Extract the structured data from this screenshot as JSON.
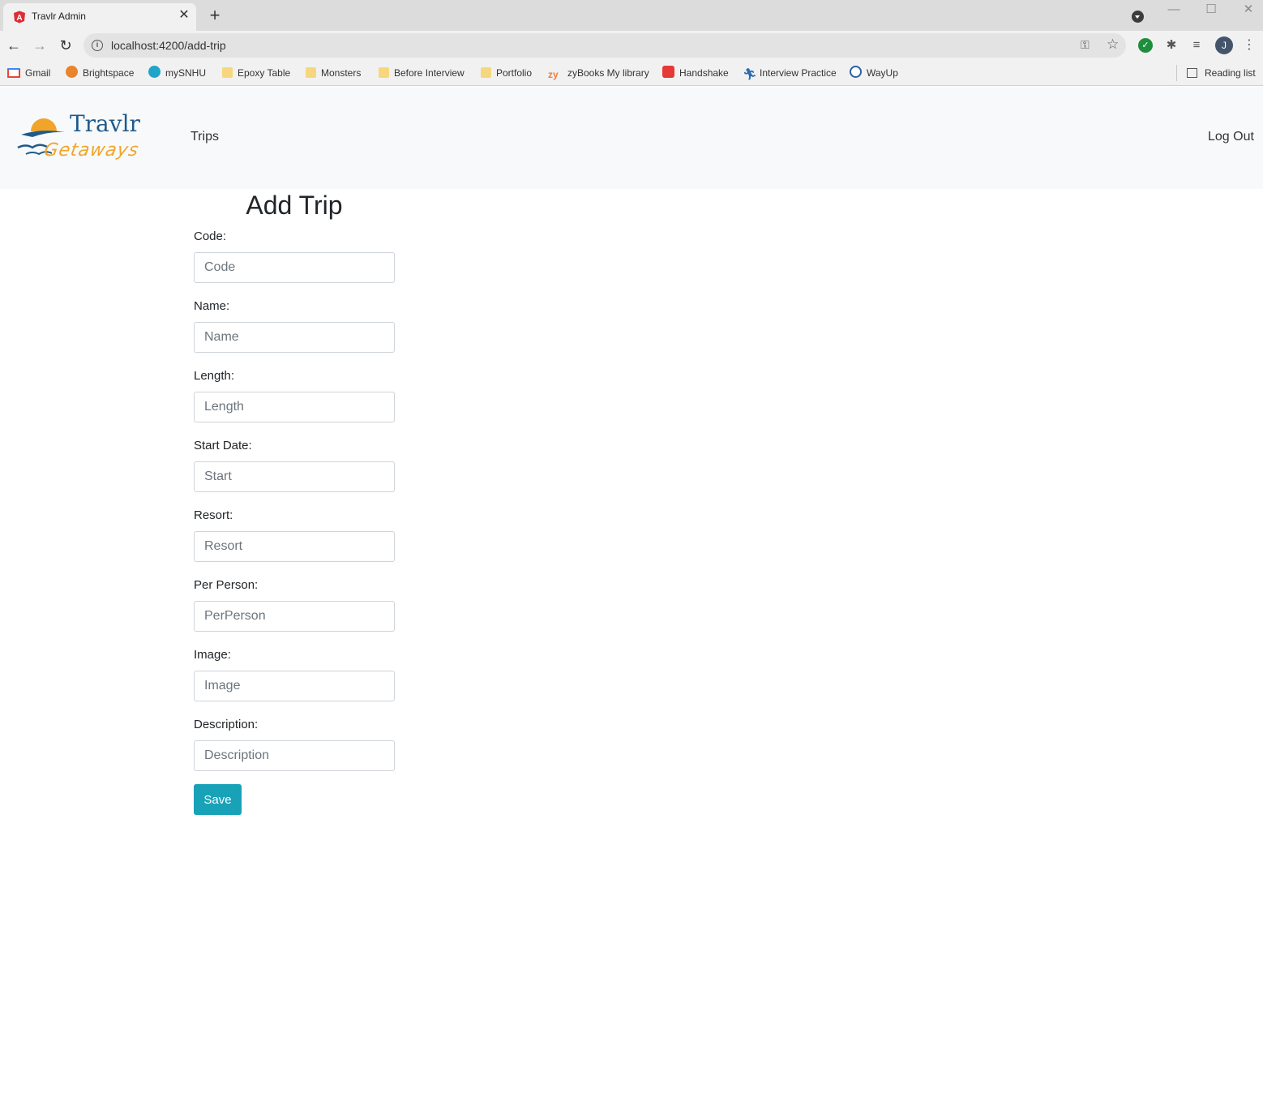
{
  "browser": {
    "tab_title": "Travlr Admin",
    "new_tab": "+",
    "close_tab": "✕",
    "url": "localhost:4200/add-trip",
    "profile_initial": "J",
    "window_controls": {
      "minimize": "—",
      "maximize": "☐",
      "close": "✕"
    },
    "bookmarks": [
      {
        "label": "Gmail",
        "icon": "gmail-icon",
        "color": "#ea4335"
      },
      {
        "label": "Brightspace",
        "icon": "brightspace-icon",
        "color": "#e8842d"
      },
      {
        "label": "mySNHU",
        "icon": "mysnhu-icon",
        "color": "#1fa5c9"
      },
      {
        "label": "Epoxy Table",
        "icon": "folder-icon",
        "color": "#f6d77d"
      },
      {
        "label": "Monsters",
        "icon": "folder-icon",
        "color": "#f6d77d"
      },
      {
        "label": "Before Interview",
        "icon": "folder-icon",
        "color": "#f6d77d"
      },
      {
        "label": "Portfolio",
        "icon": "folder-icon",
        "color": "#f6d77d"
      },
      {
        "label": "zyBooks My library",
        "icon": "zybooks-icon",
        "color": "#f47c3c"
      },
      {
        "label": "Handshake",
        "icon": "handshake-icon",
        "color": "#e53935"
      },
      {
        "label": "Interview Practice",
        "icon": "interview-practice-icon",
        "color": "#2b6cb0"
      },
      {
        "label": "WayUp",
        "icon": "wayup-icon",
        "color": "#2d5fa8"
      }
    ],
    "reading_list": "Reading list"
  },
  "app": {
    "logo": {
      "line1": "Travlr",
      "line2": "Getaways"
    },
    "nav": {
      "trips": "Trips",
      "logout": "Log Out"
    },
    "page_title": "Add Trip",
    "fields": [
      {
        "label": "Code:",
        "placeholder": "Code"
      },
      {
        "label": "Name:",
        "placeholder": "Name"
      },
      {
        "label": "Length:",
        "placeholder": "Length"
      },
      {
        "label": "Start Date:",
        "placeholder": "Start"
      },
      {
        "label": "Resort:",
        "placeholder": "Resort"
      },
      {
        "label": "Per Person:",
        "placeholder": "PerPerson"
      },
      {
        "label": "Image:",
        "placeholder": "Image"
      },
      {
        "label": "Description:",
        "placeholder": "Description"
      }
    ],
    "save_label": "Save",
    "colors": {
      "accent": "#17a2b8",
      "navbar_bg": "#f8f9fa",
      "logo_blue": "#1f5a8c",
      "logo_orange": "#f0a52a"
    }
  }
}
